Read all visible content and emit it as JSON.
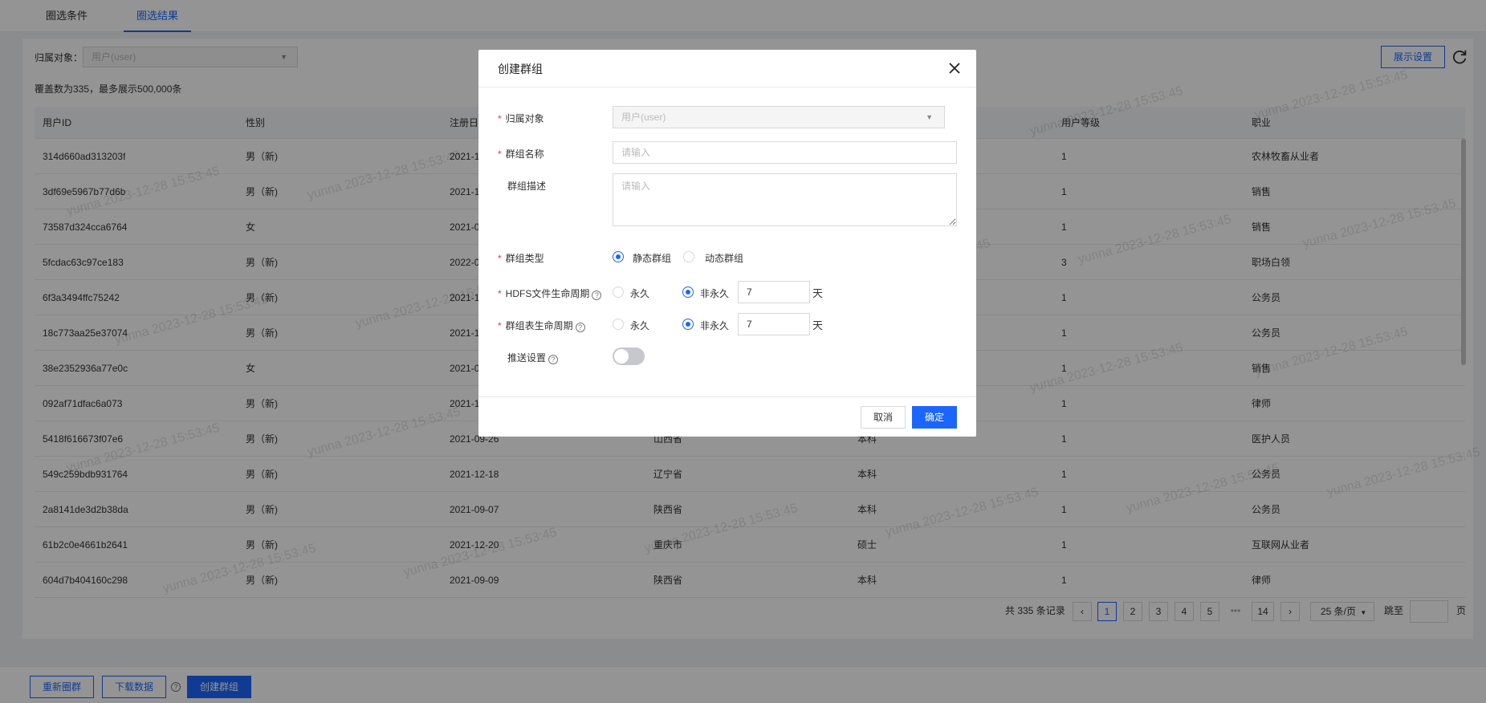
{
  "tabs": [
    "圈选条件",
    "圈选结果"
  ],
  "filter": {
    "label": "归属对象：",
    "value": "用户(user)"
  },
  "display_settings": "展示设置",
  "summary": "覆盖数为335，最多展示500,000条",
  "table": {
    "columns": [
      "用户ID",
      "性别",
      "注册日期",
      "",
      "",
      "用户等级",
      "职业"
    ],
    "rows": [
      [
        "314d660ad313203f",
        "男（新)",
        "2021-1",
        "",
        "",
        "1",
        "农林牧畜从业者"
      ],
      [
        "3df69e5967b77d6b",
        "男（新)",
        "2021-1",
        "",
        "",
        "1",
        "销售"
      ],
      [
        "73587d324cca6764",
        "女",
        "2021-0",
        "",
        "",
        "1",
        "销售"
      ],
      [
        "5fcdac63c97ce183",
        "男（新)",
        "2022-0",
        "",
        "",
        "3",
        "职场白领"
      ],
      [
        "6f3a3494ffc75242",
        "男（新)",
        "2021-1",
        "",
        "",
        "1",
        "公务员"
      ],
      [
        "18c773aa25e37074",
        "男（新)",
        "2021-1",
        "",
        "",
        "1",
        "公务员"
      ],
      [
        "38e2352936a77e0c",
        "女",
        "2021-0",
        "",
        "",
        "1",
        "销售"
      ],
      [
        "092af71dfac6a073",
        "男（新)",
        "2021-1",
        "",
        "",
        "1",
        "律师"
      ],
      [
        "5418f616673f07e6",
        "男（新)",
        "2021-09-26",
        "山西省",
        "本科",
        "1",
        "医护人员"
      ],
      [
        "549c259bdb931764",
        "男（新)",
        "2021-12-18",
        "辽宁省",
        "本科",
        "1",
        "公务员"
      ],
      [
        "2a8141de3d2b38da",
        "男（新)",
        "2021-09-07",
        "陕西省",
        "本科",
        "1",
        "公务员"
      ],
      [
        "61b2c0e4661b2641",
        "男（新)",
        "2021-12-20",
        "重庆市",
        "硕士",
        "1",
        "互联网从业者"
      ],
      [
        "604d7b404160c298",
        "男（新)",
        "2021-09-09",
        "陕西省",
        "本科",
        "1",
        "律师"
      ]
    ]
  },
  "pagination": {
    "total_text": "共 335 条记录",
    "pages": [
      "1",
      "2",
      "3",
      "4",
      "5",
      "•••",
      "14"
    ],
    "page_size": "25 条/页",
    "jump_label": "跳至",
    "page_unit": "页"
  },
  "bottom": {
    "regroup": "重新圈群",
    "download": "下载数据",
    "create": "创建群组"
  },
  "watermark": "yunna 2023-12-28 15:53:45",
  "modal": {
    "title": "创建群组",
    "fields": {
      "owner": {
        "label": "归属对象",
        "value": "用户(user)"
      },
      "name": {
        "label": "群组名称",
        "placeholder": "请输入"
      },
      "desc": {
        "label": "群组描述",
        "placeholder": "请输入"
      },
      "type": {
        "label": "群组类型",
        "options": [
          "静态群组",
          "动态群组"
        ],
        "selected": "静态群组"
      },
      "hdfs": {
        "label": "HDFS文件生命周期",
        "options": [
          "永久",
          "非永久"
        ],
        "selected": "非永久",
        "value": "7",
        "unit": "天"
      },
      "table_life": {
        "label": "群组表生命周期",
        "options": [
          "永久",
          "非永久"
        ],
        "selected": "非永久",
        "value": "7",
        "unit": "天"
      },
      "push": {
        "label": "推送设置",
        "enabled": false
      }
    },
    "cancel": "取消",
    "confirm": "确定"
  },
  "colors": {
    "primary": "#1a66ff",
    "required": "#e23c39",
    "overlay": "rgba(0,0,0,0.42)"
  },
  "icons": [
    "close-icon",
    "help-icon",
    "refresh-icon",
    "caret-down-icon",
    "chevron-left-icon",
    "chevron-right-icon"
  ]
}
